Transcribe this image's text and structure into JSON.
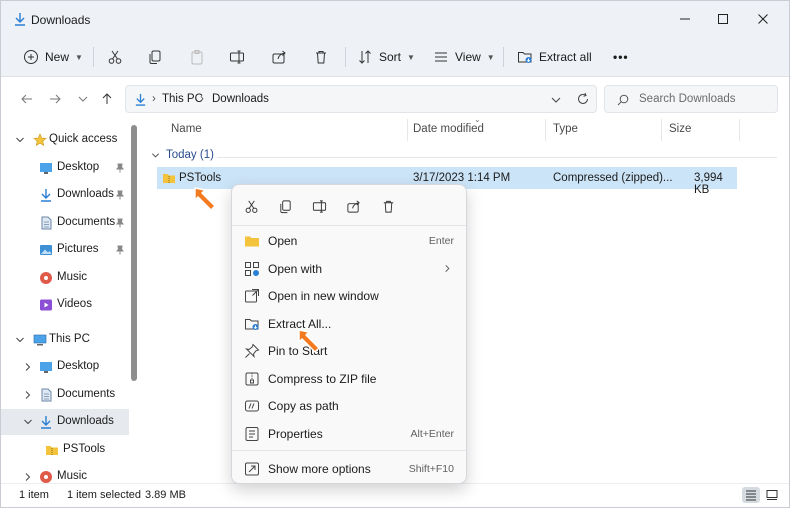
{
  "window": {
    "title": "Downloads",
    "minimize_glyph": "—",
    "accent": "#0067c0"
  },
  "toolbar": {
    "new_label": "New",
    "sort_label": "Sort",
    "view_label": "View",
    "extract_all_label": "Extract all",
    "more_label": "•••"
  },
  "address": {
    "crumb1": "This PC",
    "crumb2": "Downloads",
    "search_placeholder": "Search Downloads"
  },
  "sidebar": {
    "items": [
      {
        "label": "Quick access"
      },
      {
        "label": "Desktop"
      },
      {
        "label": "Downloads"
      },
      {
        "label": "Documents"
      },
      {
        "label": "Pictures"
      },
      {
        "label": "Music"
      },
      {
        "label": "Videos"
      },
      {
        "label": "This PC"
      },
      {
        "label": "Desktop"
      },
      {
        "label": "Documents"
      },
      {
        "label": "Downloads"
      },
      {
        "label": "PSTools"
      },
      {
        "label": "Music"
      }
    ]
  },
  "columns": {
    "name": "Name",
    "date": "Date modified",
    "type": "Type",
    "size": "Size"
  },
  "group": {
    "label": "Today (1)"
  },
  "file": {
    "name": "PSTools",
    "date": "3/17/2023 1:14 PM",
    "type": "Compressed (zipped)...",
    "size": "3,994 KB"
  },
  "context_menu": {
    "items": [
      {
        "label": "Open",
        "accel": "Enter"
      },
      {
        "label": "Open with",
        "accel": ""
      },
      {
        "label": "Open in new window",
        "accel": ""
      },
      {
        "label": "Extract All...",
        "accel": ""
      },
      {
        "label": "Pin to Start",
        "accel": ""
      },
      {
        "label": "Compress to ZIP file",
        "accel": ""
      },
      {
        "label": "Copy as path",
        "accel": ""
      },
      {
        "label": "Properties",
        "accel": "Alt+Enter"
      },
      {
        "label": "Show more options",
        "accel": "Shift+F10"
      }
    ]
  },
  "status": {
    "count": "1 item",
    "selected": "1 item selected",
    "size": "3.89 MB"
  },
  "colors": {
    "selection": "#cce4f7",
    "pointer": "#f47a20",
    "folder": "#f3c33c"
  }
}
